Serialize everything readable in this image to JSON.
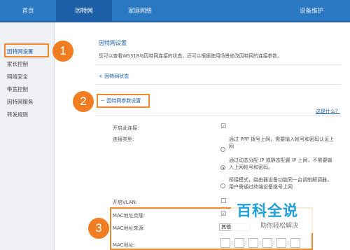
{
  "topnav": {
    "tabs": [
      {
        "label": "首页"
      },
      {
        "label": "因特网"
      },
      {
        "label": "家庭网络"
      },
      {
        "label": "设备维护"
      }
    ]
  },
  "sidebar": {
    "items": [
      {
        "label": "因特网设置"
      },
      {
        "label": "家长控制"
      },
      {
        "label": "网络安全"
      },
      {
        "label": "带宽控制"
      },
      {
        "label": "因特网服务"
      },
      {
        "label": "转发规则"
      }
    ]
  },
  "badges": {
    "one": "1",
    "two": "2",
    "three": "3"
  },
  "content": {
    "section_title": "因特网设置",
    "description": "您可以查看WS318与因特网连接的状态，还可以根据使用场景修改因特网的连接参数。",
    "status_header": "+  因特网状态",
    "params_header": "－  因特网参数设置",
    "help_link": "这是什么？",
    "enable_connection_label": "开启此连接:",
    "enable_connection_value": "☑",
    "connection_type_label": "连接类型:",
    "option1_line1": "通过 PPP 拨号上网，需要输入帐号和密码认证上",
    "option1_line2": "网",
    "option2_line1": "通过动态分配 IP 或静态配置 IP 上网，不需要输",
    "option2_line2": "入上网帐号和密码。",
    "option3_line1": "桥接模式，路由器设备功能同一台调制解调器，",
    "option3_line2": "用户需通过终端设备拨号上网",
    "vlan_label": "开启VLAN:",
    "vlan_value": "□",
    "mac_clone_label": "MAC地址克隆:",
    "mac_clone_value": "☑",
    "mac_source_label": "MAC地址来源:",
    "mac_source_value": "其他",
    "mac_address_label": "MAC地址:"
  },
  "watermark": {
    "main": "百科全说",
    "sub": "助你轻松解决"
  },
  "colors": {
    "nav": "#2a78c2",
    "highlight": "#f08a2c",
    "badge": "#f07d22"
  }
}
